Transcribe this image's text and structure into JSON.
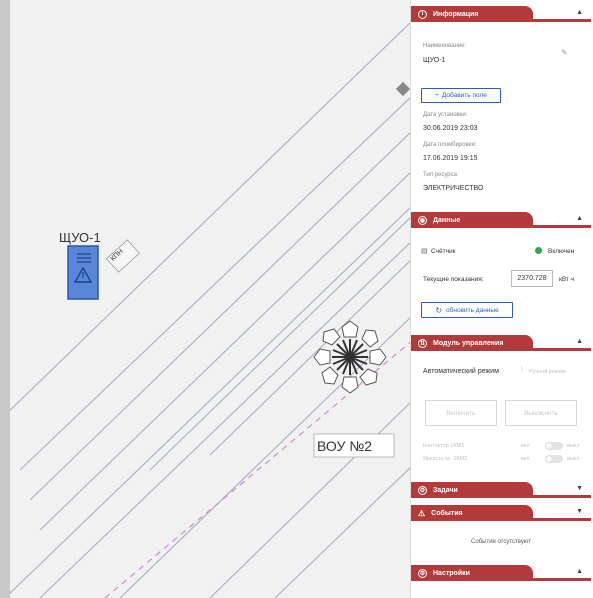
{
  "map": {
    "shuo_label": "ЩУО-1",
    "kpn_label": "КПН",
    "vou_label": "ВОУ №2"
  },
  "panel": {
    "info": {
      "title": "Информация",
      "name_label": "Наименование:",
      "name_value": "ЩУО-1",
      "add_field": "Добавить поле",
      "install_label": "Дата установки:",
      "install_value": "30.06.2019 23:03",
      "seal_label": "Дата пломбировки:",
      "seal_value": "17.06.2019 19:15",
      "resource_label": "Тип ресурса",
      "resource_value": "ЭЛЕКТРИЧЕСТВО"
    },
    "data": {
      "title": "Данные",
      "meter_label": "Счётчик",
      "status_label": "Включен",
      "status_color": "#2ea84a",
      "reading_label": "Текущие показания:",
      "reading_value": "2370.728",
      "unit": "кВт·ч",
      "refresh": "обновить данные"
    },
    "control": {
      "title": "Модуль управления",
      "auto_mode": "Автоматический режим",
      "manual_mode": "Ручной режим",
      "btn_on": "Включить",
      "btn_off": "Выключить",
      "contactor_label": "Контактор 1КМ1",
      "contactor_on": "вкл",
      "contactor_off": "выкл",
      "tariff_label": "Яркость гр. 1КМ2",
      "tariff_on": "вкл",
      "tariff_off": "выкл"
    },
    "tasks": {
      "title": "Задачи"
    },
    "events": {
      "title": "События",
      "empty": "События отсутствуют"
    },
    "settings": {
      "title": "Настройки"
    },
    "accent_color": "#b23a3a"
  }
}
